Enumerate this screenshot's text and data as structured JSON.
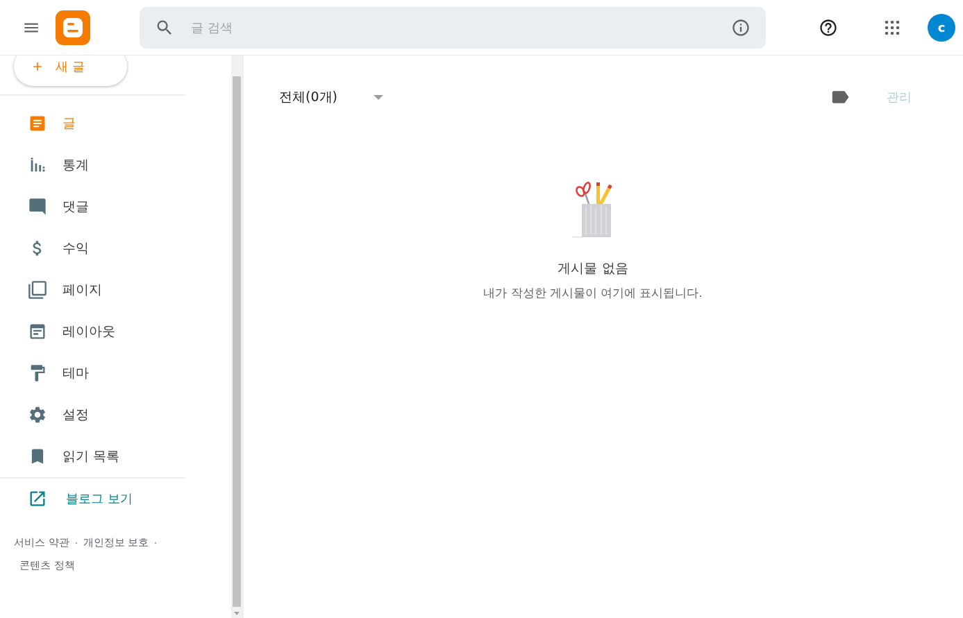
{
  "header": {
    "search": {
      "placeholder": "글 검색"
    },
    "avatar": "c"
  },
  "sidebar": {
    "new_post": "새 글",
    "items": [
      {
        "label": "글",
        "kind": "posts",
        "selected": true
      },
      {
        "label": "통계",
        "kind": "stats",
        "selected": false
      },
      {
        "label": "댓글",
        "kind": "comments",
        "selected": false
      },
      {
        "label": "수익",
        "kind": "earnings",
        "selected": false
      },
      {
        "label": "페이지",
        "kind": "pages",
        "selected": false
      },
      {
        "label": "레이아웃",
        "kind": "layout",
        "selected": false
      },
      {
        "label": "테마",
        "kind": "theme",
        "selected": false
      },
      {
        "label": "설정",
        "kind": "settings",
        "selected": false
      },
      {
        "label": "읽기 목록",
        "kind": "reading",
        "selected": false
      }
    ],
    "view_blog": "블로그 보기",
    "footer_links": [
      "서비스 약관",
      "개인정보 보호",
      "콘텐츠 정책"
    ]
  },
  "main": {
    "filter": "전체(0개)",
    "manage": {
      "label": "관리",
      "disabled": true
    },
    "empty_title": "게시물 없음",
    "empty_text": "내가 작성한 게시물이 여기에 표시됩니다."
  }
}
